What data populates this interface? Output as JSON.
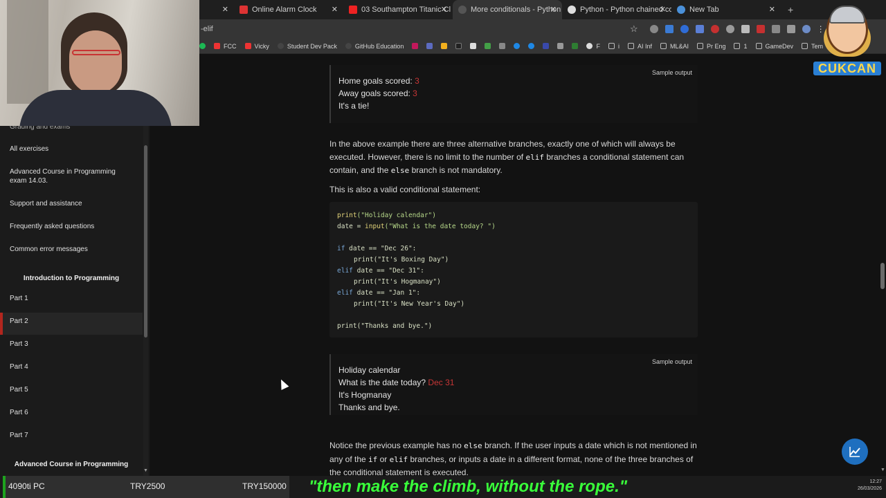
{
  "tabs": [
    {
      "label": "",
      "close": "✕"
    },
    {
      "label": "Online Alarm Clock",
      "close": "✕"
    },
    {
      "label": "03 Southampton Titanic Cl",
      "close": "✕"
    },
    {
      "label": "More conditionals - Python Pr",
      "close": "✕"
    },
    {
      "label": "Python - Python chained comp",
      "close": "✕"
    },
    {
      "label": "New Tab",
      "close": "✕"
    }
  ],
  "new_tab": "+",
  "address": {
    "url": "-elif"
  },
  "bookmarks": [
    "FCC",
    "Vicky",
    "Student Dev Pack",
    "GitHub Education",
    "F",
    "i",
    "AI Inf",
    "ML&AI",
    "Pr Eng",
    "1",
    "GameDev",
    "Tem"
  ],
  "logo": {
    "text": "CUKCAN"
  },
  "sidebar": {
    "items_top": [
      "Grading and exams",
      "All exercises",
      "Advanced Course in Programming exam 14.03.",
      "Support and assistance",
      "Frequently asked questions",
      "Common error messages"
    ],
    "heading_intro": "Introduction to Programming",
    "parts": [
      "Part 1",
      "Part 2",
      "Part 3",
      "Part 4",
      "Part 5",
      "Part 6",
      "Part 7"
    ],
    "heading_advanced": "Advanced Course in Programming"
  },
  "sample1": {
    "tag": "Sample output",
    "home_label": "Home goals scored: ",
    "home_value": "3",
    "away_label": "Away goals scored: ",
    "away_value": "3",
    "result": "It's a tie!"
  },
  "para1": {
    "a": "In the above example there are three alternative branches, exactly one of which will always be executed. However, there is no limit to the number of ",
    "code1": "elif",
    "b": " branches a conditional statement can contain, and the ",
    "code2": "else",
    "c": " branch is not mandatory."
  },
  "para2": "This is also a valid conditional statement:",
  "code": {
    "l1_fn": "print",
    "l1_str": "(\"Holiday calendar\")",
    "l2_a": "date = ",
    "l2_fn": "input",
    "l2_str": "(\"What is the date today? \")",
    "l3_kw": "if",
    "l3_rest": " date == \"Dec 26\":",
    "l4": "print(\"It's Boxing Day\")",
    "l5_kw": "elif",
    "l5_rest": " date == \"Dec 31\":",
    "l6": "print(\"It's Hogmanay\")",
    "l7_kw": "elif",
    "l7_rest": " date == \"Jan 1\":",
    "l8": "print(\"It's New Year's Day\")",
    "l9": "print(\"Thanks and bye.\")"
  },
  "sample2": {
    "tag": "Sample output",
    "line1": "Holiday calendar",
    "line2_label": "What is the date today? ",
    "line2_value": "Dec 31",
    "line3": "It's Hogmanay",
    "line4": "Thanks and bye."
  },
  "para3": {
    "a": "Notice the previous example has no ",
    "code1": "else",
    "b": " branch. If the user inputs a date which is not mentioned in any of the ",
    "code2": "if",
    "c": " or ",
    "code3": "elif",
    "d": " branches, or inputs a date in a different format, none of the three branches of the conditional statement is executed."
  },
  "ticker": {
    "item1": "4090ti PC",
    "item2": "TRY2500",
    "item3": "TRY150000",
    "quote": "\"then make the climb, without the rope.\"",
    "time": "12:27",
    "date": "26/03/2026"
  },
  "colors": {
    "accent_red": "#c73636",
    "fab_blue": "#1f6fbf",
    "quote_green": "#39ff3a"
  }
}
